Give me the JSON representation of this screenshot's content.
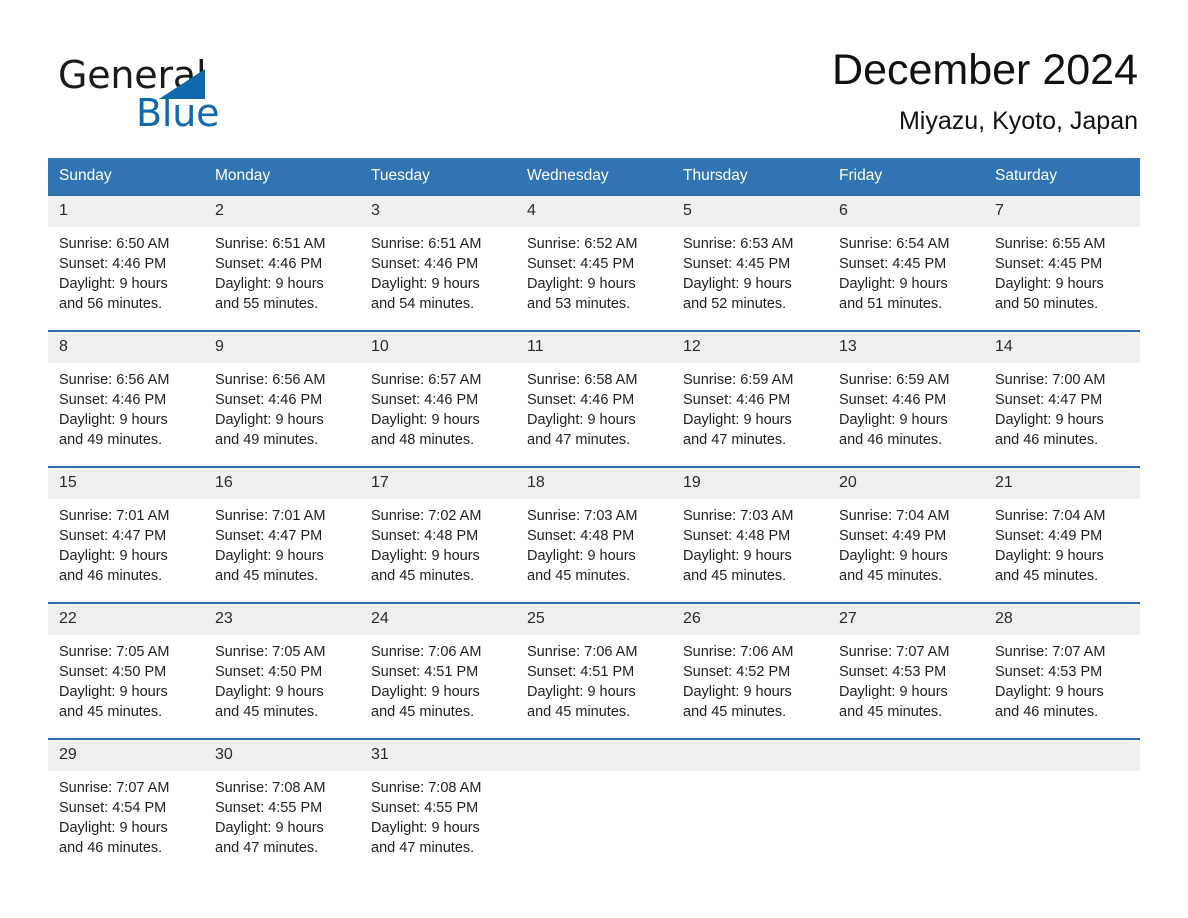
{
  "brand": {
    "line1": "General",
    "line2": "Blue",
    "mark": "triangle-logo",
    "accent_color": "#1068ad"
  },
  "header": {
    "title": "December 2024",
    "subtitle": "Miyazu, Kyoto, Japan"
  },
  "calendar": {
    "header_bg": "#3174b4",
    "day_band_bg": "#f0f0f0",
    "week_border_color": "#2f6da8",
    "weekday_headers": [
      "Sunday",
      "Monday",
      "Tuesday",
      "Wednesday",
      "Thursday",
      "Friday",
      "Saturday"
    ],
    "weeks": [
      [
        {
          "day": "1",
          "sunrise": "Sunrise: 6:50 AM",
          "sunset": "Sunset: 4:46 PM",
          "daylight_line1": "Daylight: 9 hours",
          "daylight_line2": "and 56 minutes."
        },
        {
          "day": "2",
          "sunrise": "Sunrise: 6:51 AM",
          "sunset": "Sunset: 4:46 PM",
          "daylight_line1": "Daylight: 9 hours",
          "daylight_line2": "and 55 minutes."
        },
        {
          "day": "3",
          "sunrise": "Sunrise: 6:51 AM",
          "sunset": "Sunset: 4:46 PM",
          "daylight_line1": "Daylight: 9 hours",
          "daylight_line2": "and 54 minutes."
        },
        {
          "day": "4",
          "sunrise": "Sunrise: 6:52 AM",
          "sunset": "Sunset: 4:45 PM",
          "daylight_line1": "Daylight: 9 hours",
          "daylight_line2": "and 53 minutes."
        },
        {
          "day": "5",
          "sunrise": "Sunrise: 6:53 AM",
          "sunset": "Sunset: 4:45 PM",
          "daylight_line1": "Daylight: 9 hours",
          "daylight_line2": "and 52 minutes."
        },
        {
          "day": "6",
          "sunrise": "Sunrise: 6:54 AM",
          "sunset": "Sunset: 4:45 PM",
          "daylight_line1": "Daylight: 9 hours",
          "daylight_line2": "and 51 minutes."
        },
        {
          "day": "7",
          "sunrise": "Sunrise: 6:55 AM",
          "sunset": "Sunset: 4:45 PM",
          "daylight_line1": "Daylight: 9 hours",
          "daylight_line2": "and 50 minutes."
        }
      ],
      [
        {
          "day": "8",
          "sunrise": "Sunrise: 6:56 AM",
          "sunset": "Sunset: 4:46 PM",
          "daylight_line1": "Daylight: 9 hours",
          "daylight_line2": "and 49 minutes."
        },
        {
          "day": "9",
          "sunrise": "Sunrise: 6:56 AM",
          "sunset": "Sunset: 4:46 PM",
          "daylight_line1": "Daylight: 9 hours",
          "daylight_line2": "and 49 minutes."
        },
        {
          "day": "10",
          "sunrise": "Sunrise: 6:57 AM",
          "sunset": "Sunset: 4:46 PM",
          "daylight_line1": "Daylight: 9 hours",
          "daylight_line2": "and 48 minutes."
        },
        {
          "day": "11",
          "sunrise": "Sunrise: 6:58 AM",
          "sunset": "Sunset: 4:46 PM",
          "daylight_line1": "Daylight: 9 hours",
          "daylight_line2": "and 47 minutes."
        },
        {
          "day": "12",
          "sunrise": "Sunrise: 6:59 AM",
          "sunset": "Sunset: 4:46 PM",
          "daylight_line1": "Daylight: 9 hours",
          "daylight_line2": "and 47 minutes."
        },
        {
          "day": "13",
          "sunrise": "Sunrise: 6:59 AM",
          "sunset": "Sunset: 4:46 PM",
          "daylight_line1": "Daylight: 9 hours",
          "daylight_line2": "and 46 minutes."
        },
        {
          "day": "14",
          "sunrise": "Sunrise: 7:00 AM",
          "sunset": "Sunset: 4:47 PM",
          "daylight_line1": "Daylight: 9 hours",
          "daylight_line2": "and 46 minutes."
        }
      ],
      [
        {
          "day": "15",
          "sunrise": "Sunrise: 7:01 AM",
          "sunset": "Sunset: 4:47 PM",
          "daylight_line1": "Daylight: 9 hours",
          "daylight_line2": "and 46 minutes."
        },
        {
          "day": "16",
          "sunrise": "Sunrise: 7:01 AM",
          "sunset": "Sunset: 4:47 PM",
          "daylight_line1": "Daylight: 9 hours",
          "daylight_line2": "and 45 minutes."
        },
        {
          "day": "17",
          "sunrise": "Sunrise: 7:02 AM",
          "sunset": "Sunset: 4:48 PM",
          "daylight_line1": "Daylight: 9 hours",
          "daylight_line2": "and 45 minutes."
        },
        {
          "day": "18",
          "sunrise": "Sunrise: 7:03 AM",
          "sunset": "Sunset: 4:48 PM",
          "daylight_line1": "Daylight: 9 hours",
          "daylight_line2": "and 45 minutes."
        },
        {
          "day": "19",
          "sunrise": "Sunrise: 7:03 AM",
          "sunset": "Sunset: 4:48 PM",
          "daylight_line1": "Daylight: 9 hours",
          "daylight_line2": "and 45 minutes."
        },
        {
          "day": "20",
          "sunrise": "Sunrise: 7:04 AM",
          "sunset": "Sunset: 4:49 PM",
          "daylight_line1": "Daylight: 9 hours",
          "daylight_line2": "and 45 minutes."
        },
        {
          "day": "21",
          "sunrise": "Sunrise: 7:04 AM",
          "sunset": "Sunset: 4:49 PM",
          "daylight_line1": "Daylight: 9 hours",
          "daylight_line2": "and 45 minutes."
        }
      ],
      [
        {
          "day": "22",
          "sunrise": "Sunrise: 7:05 AM",
          "sunset": "Sunset: 4:50 PM",
          "daylight_line1": "Daylight: 9 hours",
          "daylight_line2": "and 45 minutes."
        },
        {
          "day": "23",
          "sunrise": "Sunrise: 7:05 AM",
          "sunset": "Sunset: 4:50 PM",
          "daylight_line1": "Daylight: 9 hours",
          "daylight_line2": "and 45 minutes."
        },
        {
          "day": "24",
          "sunrise": "Sunrise: 7:06 AM",
          "sunset": "Sunset: 4:51 PM",
          "daylight_line1": "Daylight: 9 hours",
          "daylight_line2": "and 45 minutes."
        },
        {
          "day": "25",
          "sunrise": "Sunrise: 7:06 AM",
          "sunset": "Sunset: 4:51 PM",
          "daylight_line1": "Daylight: 9 hours",
          "daylight_line2": "and 45 minutes."
        },
        {
          "day": "26",
          "sunrise": "Sunrise: 7:06 AM",
          "sunset": "Sunset: 4:52 PM",
          "daylight_line1": "Daylight: 9 hours",
          "daylight_line2": "and 45 minutes."
        },
        {
          "day": "27",
          "sunrise": "Sunrise: 7:07 AM",
          "sunset": "Sunset: 4:53 PM",
          "daylight_line1": "Daylight: 9 hours",
          "daylight_line2": "and 45 minutes."
        },
        {
          "day": "28",
          "sunrise": "Sunrise: 7:07 AM",
          "sunset": "Sunset: 4:53 PM",
          "daylight_line1": "Daylight: 9 hours",
          "daylight_line2": "and 46 minutes."
        }
      ],
      [
        {
          "day": "29",
          "sunrise": "Sunrise: 7:07 AM",
          "sunset": "Sunset: 4:54 PM",
          "daylight_line1": "Daylight: 9 hours",
          "daylight_line2": "and 46 minutes."
        },
        {
          "day": "30",
          "sunrise": "Sunrise: 7:08 AM",
          "sunset": "Sunset: 4:55 PM",
          "daylight_line1": "Daylight: 9 hours",
          "daylight_line2": "and 47 minutes."
        },
        {
          "day": "31",
          "sunrise": "Sunrise: 7:08 AM",
          "sunset": "Sunset: 4:55 PM",
          "daylight_line1": "Daylight: 9 hours",
          "daylight_line2": "and 47 minutes."
        },
        {
          "day": "",
          "sunrise": "",
          "sunset": "",
          "daylight_line1": "",
          "daylight_line2": ""
        },
        {
          "day": "",
          "sunrise": "",
          "sunset": "",
          "daylight_line1": "",
          "daylight_line2": ""
        },
        {
          "day": "",
          "sunrise": "",
          "sunset": "",
          "daylight_line1": "",
          "daylight_line2": ""
        },
        {
          "day": "",
          "sunrise": "",
          "sunset": "",
          "daylight_line1": "",
          "daylight_line2": ""
        }
      ]
    ]
  }
}
